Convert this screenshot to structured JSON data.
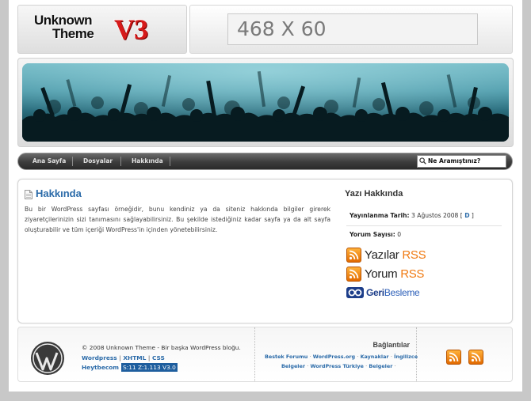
{
  "header": {
    "logo_line1": "Unknown",
    "logo_line2": "Theme",
    "logo_version": "V3",
    "ad_text": "468 X 60"
  },
  "nav": {
    "items": [
      {
        "label": "Ana Sayfa"
      },
      {
        "label": "Dosyalar"
      },
      {
        "label": "Hakkında"
      }
    ],
    "search_placeholder": "Ne Aramıştınız?"
  },
  "post": {
    "title": "Hakkında",
    "body": "Bu bir WordPress sayfası örneğidir, bunu kendiniz ya da siteniz hakkında bilgiler girerek ziyaretçilerinizin sizi tanımasını sağlayabilirsiniz. Bu şekilde istediğiniz kadar sayfa ya da alt sayfa oluşturabilir ve tüm içeriği WordPress'in içinden yönetebilirsiniz."
  },
  "sidebar": {
    "title": "Yazı Hakkında",
    "published_label": "Yayınlanma Tarih:",
    "published_date": "3 Ağustos 2008",
    "bracket_open": "[",
    "d_link": "D",
    "bracket_close": "]",
    "comments_label": "Yorum Sayısı:",
    "comments_count": "0",
    "rss_posts_a": "Yazılar",
    "rss_posts_b": "RSS",
    "rss_comments_a": "Yorum",
    "rss_comments_b": "RSS",
    "feedback_a": "Geri",
    "feedback_b": "Besleme"
  },
  "footer": {
    "copyright": "© 2008 Unknown Theme - Bir başka WordPress bloğu.",
    "link_wordpress": "Wordpress",
    "link_xhtml": "XHTML",
    "link_css": "CSS",
    "sep": "|",
    "credit": "Heytbecom",
    "badge": "S:11 Z:1.113 V3.0",
    "links_title": "Bağlantılar",
    "links_row1": [
      "Bestek Forumu",
      "WordPress.org",
      "Kaynaklar",
      "İngilizce"
    ],
    "links_row2": [
      "Belgeler",
      "WordPress Türkiye",
      "Belgeler"
    ],
    "dot": "·"
  },
  "colors": {
    "link": "#2a6aa8",
    "rss_orange": "#f07a12",
    "accent_red": "#d61a1a"
  }
}
